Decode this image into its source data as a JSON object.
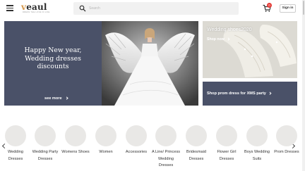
{
  "header": {
    "logo_text": "eaul",
    "logo_letter": "v",
    "logo_tagline": "DRESS THE LOVE IN LIFE",
    "search_placeholder": "Search",
    "cart_count": "0",
    "signin_label": "Sign in"
  },
  "hero": {
    "title_line1": "Happy New year,",
    "title_line2": "Wedding dresses",
    "title_line3": "discounts",
    "see_more_label": "see more"
  },
  "promos": {
    "top_title": "Wedding shoes2020",
    "top_link": "Shop now",
    "bottom_link": "Shop prom dress for XMS party"
  },
  "categories": [
    {
      "line1": "Wedding",
      "line2": "Dresses",
      "line3": ""
    },
    {
      "line1": "Wedding Party",
      "line2": "Dresses",
      "line3": ""
    },
    {
      "line1": "Womens Shoes",
      "line2": "",
      "line3": ""
    },
    {
      "line1": "Women",
      "line2": "",
      "line3": ""
    },
    {
      "line1": "Accessories",
      "line2": "",
      "line3": ""
    },
    {
      "line1": "A Line/ Princess",
      "line2": "Wedding",
      "line3": "Dresses"
    },
    {
      "line1": "Bridesmaid",
      "line2": "Dresses",
      "line3": ""
    },
    {
      "line1": "Flower Girl",
      "line2": "Dresses",
      "line3": ""
    },
    {
      "line1": "Boys Wedding",
      "line2": "Suits",
      "line3": ""
    },
    {
      "line1": "Prom Dresses",
      "line2": "",
      "line3": ""
    }
  ],
  "colors": {
    "banner_bg": "#4a5168",
    "badge": "#e53935",
    "logo_accent": "#d79a4e"
  }
}
